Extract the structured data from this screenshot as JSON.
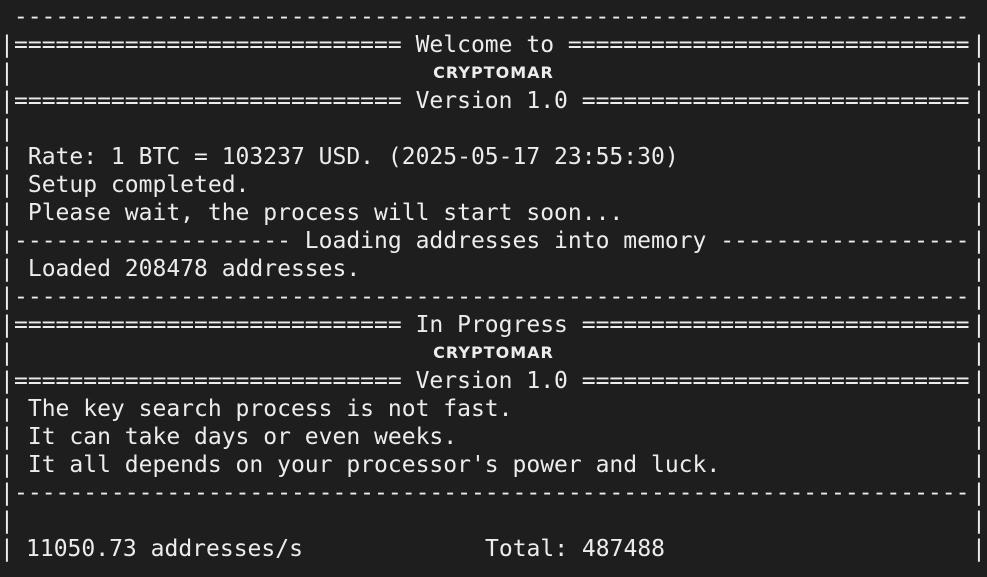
{
  "terminal": {
    "top_rule": " ---------------------------------------------------------------------",
    "welcome_banner": "============================ Welcome to =============================",
    "brand": "CRYPTOMAR",
    "version_banner": "============================ Version 1.0 ============================",
    "rate_line": " Rate: 1 BTC = 103237 USD. (2025-05-17 23:55:30)",
    "setup_line": " Setup completed.",
    "wait_line": " Please wait, the process will start soon...",
    "loading_banner": "-------------------- Loading addresses into memory ------------------",
    "loaded_line": " Loaded 208478 addresses.",
    "rule": "---------------------------------------------------------------------",
    "progress_banner": "============================ In Progress ============================",
    "info_lines": [
      " The key search process is not fast.",
      " It can take days or even weeks.",
      " It all depends on your processor's power and luck."
    ],
    "speed": "11050.73 addresses/s",
    "total": "Total: 487488"
  },
  "colors": {
    "background": "#1e1e1e",
    "text": "#ececec"
  }
}
